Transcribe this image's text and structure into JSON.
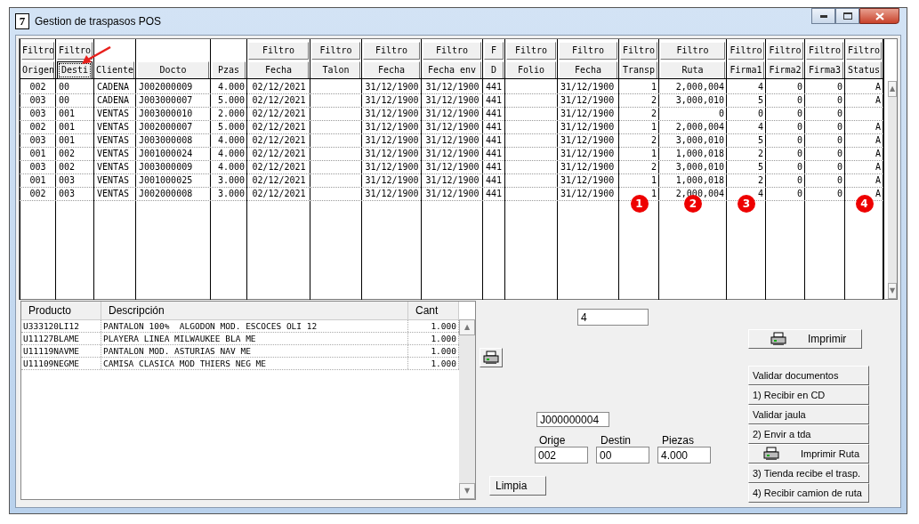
{
  "window": {
    "title": "Gestion de traspasos POS",
    "app_icon": "7"
  },
  "grid": {
    "columns": [
      {
        "filter": "Filtro",
        "label": "Origen",
        "selected": false
      },
      {
        "filter": "Filtro",
        "label": "Desti",
        "selected": true,
        "pointer_arrow": true
      },
      {
        "label": "Cliente",
        "selected": false
      },
      {
        "label": "Docto",
        "selected": false
      },
      {
        "label": "Pzas",
        "selected": false
      },
      {
        "filter": "Filtro",
        "label": "Fecha",
        "selected": false
      },
      {
        "filter": "Filtro",
        "label": "Talon",
        "selected": false
      },
      {
        "filter": "Filtro",
        "label": "Fecha",
        "selected": false
      },
      {
        "filter": "Filtro",
        "label": "Fecha env",
        "selected": false
      },
      {
        "filter": "F",
        "label": "D",
        "selected": false
      },
      {
        "filter": "Filtro",
        "label": "Folio",
        "selected": false
      },
      {
        "filter": "Filtro",
        "label": "Fecha",
        "selected": false
      },
      {
        "filter": "Filtro",
        "label": "Transp",
        "selected": false,
        "badge": "1"
      },
      {
        "filter": "Filtro",
        "label": "Ruta",
        "selected": false,
        "badge": "2"
      },
      {
        "filter": "Filtro",
        "label": "Firma1",
        "selected": false,
        "badge": "3"
      },
      {
        "filter": "Filtro",
        "label": "Firma2",
        "selected": false
      },
      {
        "filter": "Filtro",
        "label": "Firma3",
        "selected": false
      },
      {
        "filter": "Filtro",
        "label": "Status",
        "selected": false,
        "badge": "4"
      }
    ],
    "rows": [
      [
        "002",
        "00",
        "CADENA",
        "J002000009",
        "4.000",
        "02/12/2021",
        null,
        "31/12/1900",
        "31/12/1900",
        "441",
        null,
        "31/12/1900",
        "1",
        "2,000,004",
        "4",
        "0",
        "0",
        "A"
      ],
      [
        "003",
        "00",
        "CADENA",
        "J003000007",
        "5.000",
        "02/12/2021",
        null,
        "31/12/1900",
        "31/12/1900",
        "441",
        null,
        "31/12/1900",
        "2",
        "3,000,010",
        "5",
        "0",
        "0",
        "A"
      ],
      [
        "003",
        "001",
        "VENTAS",
        "J003000010",
        "2.000",
        "02/12/2021",
        null,
        "31/12/1900",
        "31/12/1900",
        "441",
        null,
        "31/12/1900",
        "2",
        "0",
        "0",
        "0",
        "0",
        null
      ],
      [
        "002",
        "001",
        "VENTAS",
        "J002000007",
        "5.000",
        "02/12/2021",
        null,
        "31/12/1900",
        "31/12/1900",
        "441",
        null,
        "31/12/1900",
        "1",
        "2,000,004",
        "4",
        "0",
        "0",
        "A"
      ],
      [
        "003",
        "001",
        "VENTAS",
        "J003000008",
        "4.000",
        "02/12/2021",
        null,
        "31/12/1900",
        "31/12/1900",
        "441",
        null,
        "31/12/1900",
        "2",
        "3,000,010",
        "5",
        "0",
        "0",
        "A"
      ],
      [
        "001",
        "002",
        "VENTAS",
        "J001000024",
        "4.000",
        "02/12/2021",
        null,
        "31/12/1900",
        "31/12/1900",
        "441",
        null,
        "31/12/1900",
        "1",
        "1,000,018",
        "2",
        "0",
        "0",
        "A"
      ],
      [
        "003",
        "002",
        "VENTAS",
        "J003000009",
        "4.000",
        "02/12/2021",
        null,
        "31/12/1900",
        "31/12/1900",
        "441",
        null,
        "31/12/1900",
        "2",
        "3,000,010",
        "5",
        "0",
        "0",
        "A"
      ],
      [
        "001",
        "003",
        "VENTAS",
        "J001000025",
        "3.000",
        "02/12/2021",
        null,
        "31/12/1900",
        "31/12/1900",
        "441",
        null,
        "31/12/1900",
        "1",
        "1,000,018",
        "2",
        "0",
        "0",
        "A"
      ],
      [
        "002",
        "003",
        "VENTAS",
        "J002000008",
        "3.000",
        "02/12/2021",
        null,
        "31/12/1900",
        "31/12/1900",
        "441",
        null,
        "31/12/1900",
        "1",
        "2,000,004",
        "4",
        "0",
        "0",
        "A"
      ]
    ],
    "scroll_up": "▲",
    "scroll_down": "▼"
  },
  "products": {
    "columns": [
      "Producto",
      "Descripción",
      "Cant"
    ],
    "rows": [
      [
        "U333120LI12",
        "PANTALON 100%  ALGODON MOD. ESCOCES OLI 12",
        "1.000"
      ],
      [
        "U11127BLAME",
        "PLAYERA LINEA MILWAUKEE BLA ME",
        "1.000"
      ],
      [
        "U11119NAVME",
        "PANTALON MOD. ASTURIAS NAV ME",
        "1.000"
      ],
      [
        "U11109NEGME",
        "CAMISA CLASICA MOD THIERS NEG ME",
        "1.000"
      ]
    ],
    "scroll_up": "▲",
    "scroll_down": "▼"
  },
  "count_field": {
    "value": "4"
  },
  "doc_field": {
    "value": "J000000004"
  },
  "fields": [
    {
      "label": "Orige",
      "value": "002"
    },
    {
      "label": "Destin",
      "value": "00"
    },
    {
      "label": "Piezas",
      "value": "4.000"
    }
  ],
  "clear_button": "Limpia",
  "print_button": "Imprimir",
  "actions": [
    {
      "label": "Validar documentos",
      "icon": false
    },
    {
      "label": "1) Recibir en CD",
      "icon": false
    },
    {
      "label": "Validar jaula",
      "icon": false
    },
    {
      "label": "2) Envir a tda",
      "icon": false
    },
    {
      "label": "Imprimir Ruta",
      "icon": true
    },
    {
      "label": "3) Tienda recibe el trasp.",
      "icon": false
    },
    {
      "label": "4) Recibir camion de ruta",
      "icon": false
    }
  ]
}
